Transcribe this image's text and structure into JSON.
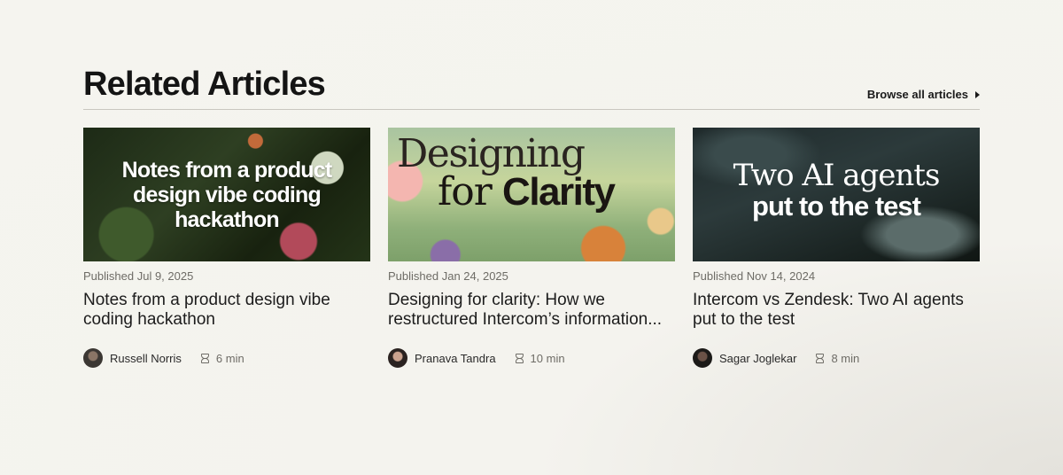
{
  "section": {
    "title": "Related Articles",
    "browse_label": "Browse all articles"
  },
  "articles": [
    {
      "thumbnail_text": "Notes from a product design vibe coding hackathon",
      "published": "Published Jul 9, 2025",
      "headline": "Notes from a product design vibe coding hackathon",
      "author": "Russell Norris",
      "read_time": "6 min"
    },
    {
      "thumbnail_text_line1": "Designing",
      "thumbnail_text_line2a": "for",
      "thumbnail_text_line2b": "Clarity",
      "published": "Published Jan 24, 2025",
      "headline": "Designing for clarity: How we restructured Intercom’s information...",
      "author": "Pranava Tandra",
      "read_time": "10 min"
    },
    {
      "thumbnail_text_line1": "Two AI agents",
      "thumbnail_text_line2": "put to the test",
      "published": "Published Nov 14, 2024",
      "headline": "Intercom vs Zendesk: Two AI agents put to the test",
      "author": "Sagar Joglekar",
      "read_time": "8 min"
    }
  ],
  "icons": {
    "browse_arrow": "caret-right-icon",
    "read_time": "hourglass-icon"
  }
}
